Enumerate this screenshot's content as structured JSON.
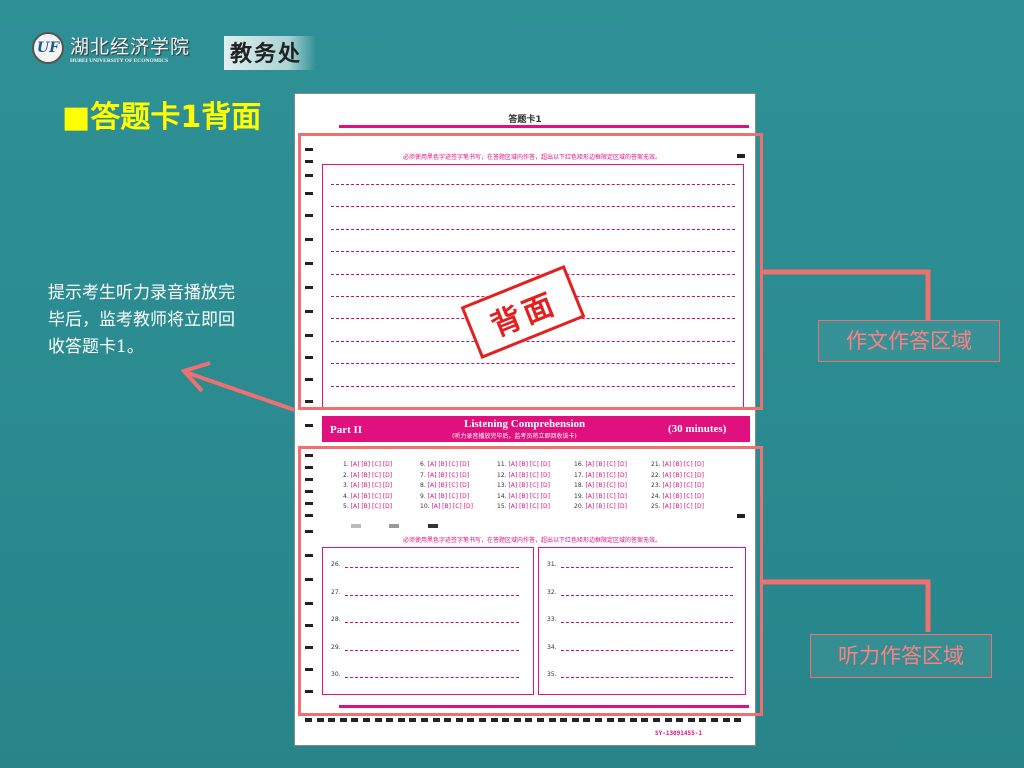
{
  "logo": {
    "emblem": "UF",
    "university_cn": "湖北经济学院",
    "university_en": "HUBEI UNIVERSITY OF ECONOMICS",
    "department": "教务处"
  },
  "slide": {
    "bullet": "■",
    "title": "答题卡1背面",
    "note": "提示考生听力录音播放完毕后，监考教师将立即回收答题卡1。"
  },
  "sheet": {
    "header": "答题卡1",
    "instruction": "必须使用黑色字迹签字笔书写，在答题区域内作答，超出以下红色矩形边框限定区域的答案无效。",
    "stamp": "背面",
    "part_label": "Part II",
    "part_title": "Listening Comprehension",
    "part_subtitle": "(听力录音播放完毕后，监考员将立即回收该卡)",
    "part_time": "(30 minutes)",
    "mc_numbers": [
      [
        "1.",
        "2.",
        "3.",
        "4.",
        "5."
      ],
      [
        "6.",
        "7.",
        "8.",
        "9.",
        "10."
      ],
      [
        "11.",
        "12.",
        "13.",
        "14.",
        "15."
      ],
      [
        "16.",
        "17.",
        "18.",
        "19.",
        "20."
      ],
      [
        "21.",
        "22.",
        "23.",
        "24.",
        "25."
      ]
    ],
    "mc_options": "[A] [B] [C] [D]",
    "short_left": [
      "26.",
      "27.",
      "28.",
      "29.",
      "30."
    ],
    "short_right": [
      "31.",
      "32.",
      "33.",
      "34.",
      "35."
    ],
    "serial": "SY-13091455-1"
  },
  "callouts": {
    "writing": "作文作答区域",
    "listening": "听力作答区域"
  },
  "colors": {
    "callout_red": "#f07070",
    "title_yellow": "#ffff00",
    "sheet_pink": "#e0107f"
  }
}
